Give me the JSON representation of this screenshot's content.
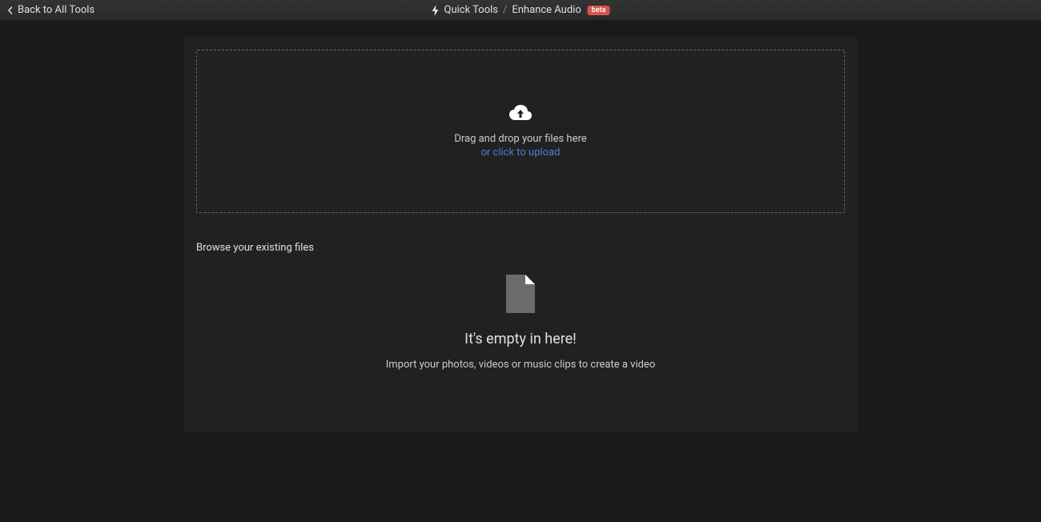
{
  "header": {
    "back_label": "Back to All Tools",
    "breadcrumb": {
      "parent": "Quick Tools",
      "current": "Enhance Audio",
      "badge": "beta"
    }
  },
  "dropzone": {
    "text": "Drag and drop your files here",
    "link": "or click to upload"
  },
  "browse": {
    "title": "Browse your existing files",
    "empty_title": "It's empty in here!",
    "empty_subtitle": "Import your photos, videos or music clips to create a video"
  }
}
